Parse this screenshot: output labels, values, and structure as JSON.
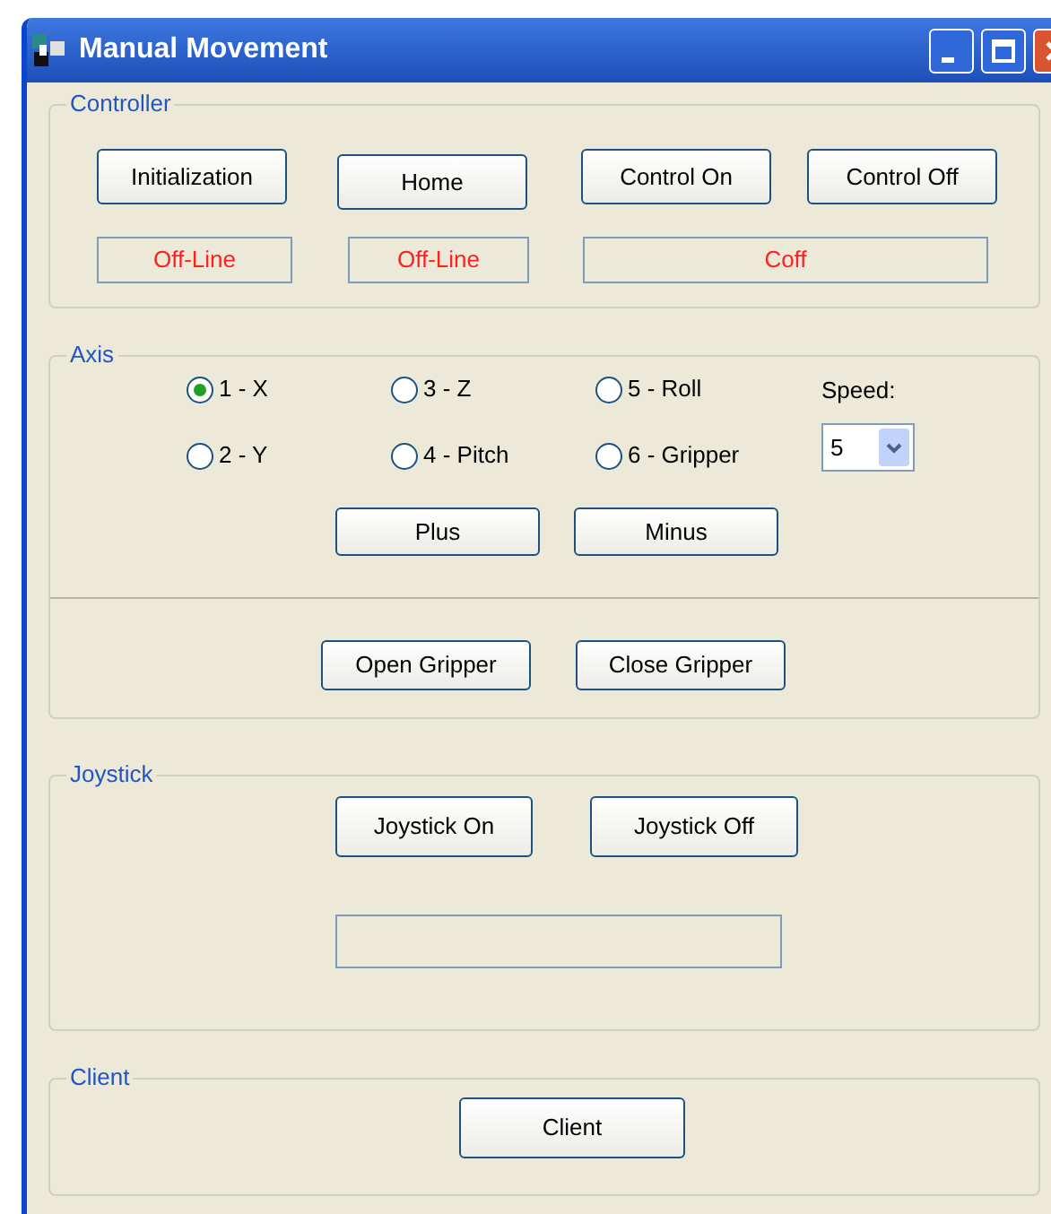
{
  "window": {
    "title": "Manual Movement"
  },
  "controller": {
    "legend": "Controller",
    "buttons": [
      "Initialization",
      "Home",
      "Control On",
      "Control Off"
    ],
    "statuses": [
      "Off-Line",
      "Off-Line",
      "Coff"
    ]
  },
  "axis": {
    "legend": "Axis",
    "options": [
      {
        "label": "1 - X",
        "selected": true
      },
      {
        "label": "2 - Y",
        "selected": false
      },
      {
        "label": "3 - Z",
        "selected": false
      },
      {
        "label": "4 - Pitch",
        "selected": false
      },
      {
        "label": "5 - Roll",
        "selected": false
      },
      {
        "label": "6 - Gripper",
        "selected": false
      }
    ],
    "speed_label": "Speed:",
    "speed_value": "5",
    "move_buttons": [
      "Plus",
      "Minus"
    ],
    "gripper_buttons": [
      "Open Gripper",
      "Close Gripper"
    ]
  },
  "joystick": {
    "legend": "Joystick",
    "buttons": [
      "Joystick On",
      "Joystick Off"
    ]
  },
  "client": {
    "legend": "Client",
    "button": "Client"
  }
}
